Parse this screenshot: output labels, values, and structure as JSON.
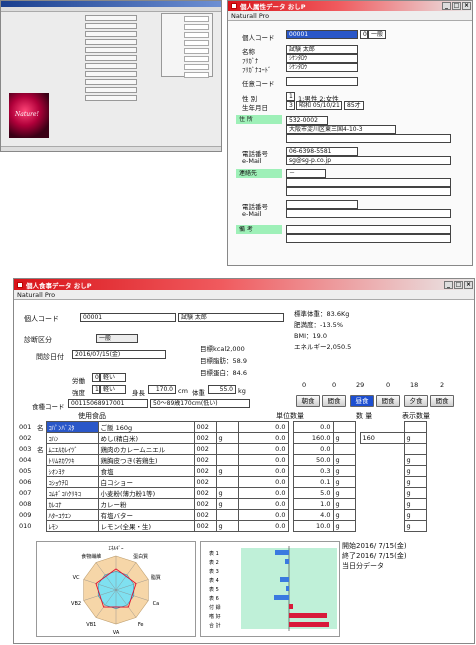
{
  "thumb": {
    "photo_text": "Nature!"
  },
  "pinfo": {
    "title": "個人属性データ おしP",
    "menu": "Naturall Pro",
    "code_label": "個人コード",
    "code_value": "00001",
    "code_type_no": "0",
    "code_type": "一般",
    "name_label": "名称",
    "name_value": "試験 太郎",
    "kana1_label": "ﾌﾘｶﾞﾅ",
    "kana1_value": "ｼｹﾝﾀﾛｳ",
    "kana2_label": "ﾌﾘｶﾞﾅｺｰﾄﾞ",
    "kana2_value": "ｼｹﾝﾀﾛｳ",
    "ncode_label": "任意コード",
    "sex_label": "性 別",
    "sex_value": "1",
    "sex_hint": "1:男性 2:女性",
    "birth_label": "生年月日",
    "birth_era": "3",
    "birth_date": "昭和 05/10/21",
    "birth_age": "85才",
    "addr_label": "住 所",
    "zip": "532-0002",
    "addr1": "大阪市淀川区東三国4-10-3",
    "tel_label": "電話番号",
    "tel_value": "06-6398-5581",
    "mail_label": "e-Mail",
    "mail_value": "sg@sg-p.co.jp",
    "contact_label": "連絡先",
    "contact_value": "－",
    "tel2_label": "電話番号",
    "mail2_label": "e-Mail",
    "note_label": "備 考"
  },
  "diet": {
    "title": "個人食事データ おしP",
    "menu": "Naturall Pro",
    "code_label": "個人コード",
    "code_value": "00001",
    "name_value": "試験 太郎",
    "category_label": "診断区分",
    "category_value": "一般",
    "date_label": "問診日付",
    "date_value": "2016/07/15(金)",
    "target_kcal": "目標kcal2,000",
    "target_fat": "目標脂肪：58.9",
    "target_protein": "目標蛋白：84.6",
    "std_weight": "標準体重：83.6Kg",
    "obesity": "肥満度：-13.5%",
    "bmi": "BMI：19.0",
    "energy": "エネルギー2,050.5",
    "work_label": "労働",
    "work_no": "0",
    "work_value": "軽い",
    "strength_label": "強度",
    "strength_no": "1",
    "strength_value": "軽い",
    "height_label": "身長",
    "height_value": "170.0",
    "height_unit": "cm",
    "weight_label": "体重",
    "weight_value": "55.0",
    "weight_unit": "kg",
    "meal_code_label": "食種コード",
    "meal_code": "00115068917001",
    "meal_desc": "50〜89歳170cm(低い)",
    "meal_counts": [
      "0",
      "0",
      "29",
      "0",
      "18",
      "2"
    ],
    "meal_buttons": [
      "朝食",
      "間食",
      "昼食",
      "間食",
      "夕食",
      "間食"
    ],
    "col_food": "使用食品",
    "col_unit": "単位数量",
    "col_qty": "数 量",
    "col_disp": "表示数量",
    "rows": [
      {
        "no": "001",
        "mark": "名",
        "code": "ｺﾊﾟﾝﾊﾞｽﾀ",
        "food": "ご飯 160g",
        "u": "002",
        "ul": "",
        "uq": "0.0",
        "qty": "0.0",
        "disp": "",
        "dl": ""
      },
      {
        "no": "002",
        "mark": "",
        "code": "ｺﾊﾝ",
        "food": "めし(精白米)",
        "u": "002",
        "ul": "g",
        "uq": "0.0",
        "qty": "160.0",
        "disp": "160",
        "dl": "g"
      },
      {
        "no": "003",
        "mark": "名",
        "code": "ﾑﾆｴﾙｶﾚｲﾂﾞ",
        "food": "鶏肉のカレームニエル",
        "u": "002",
        "ul": "",
        "uq": "0.0",
        "qty": "0.0",
        "disp": "",
        "dl": ""
      },
      {
        "no": "004",
        "mark": "",
        "code": "ﾄﾘﾑﾈｶﾜﾂｷ",
        "food": "鶏胸皮つき(若鶏生)",
        "u": "002",
        "ul": "",
        "uq": "0.0",
        "qty": "50.0",
        "disp": "",
        "dl": "g"
      },
      {
        "no": "005",
        "mark": "",
        "code": "ｼｵﾝﾖｸ",
        "food": "食塩",
        "u": "002",
        "ul": "g",
        "uq": "0.0",
        "qty": "0.3",
        "disp": "",
        "dl": "g"
      },
      {
        "no": "006",
        "mark": "",
        "code": "ｺｼｮｳﾁﾛ",
        "food": "白コショー",
        "u": "002",
        "ul": "",
        "uq": "0.0",
        "qty": "0.1",
        "disp": "",
        "dl": "g"
      },
      {
        "no": "007",
        "mark": "",
        "code": "ｺﾑｷﾞｺﾊｸﾘｷｺ",
        "food": "小麦粉(薄力粉1等)",
        "u": "002",
        "ul": "g",
        "uq": "0.0",
        "qty": "5.0",
        "disp": "",
        "dl": "g"
      },
      {
        "no": "008",
        "mark": "",
        "code": "ｶﾚｺﾅ",
        "food": "カレー粉",
        "u": "002",
        "ul": "g",
        "uq": "0.0",
        "qty": "1.0",
        "disp": "",
        "dl": "g"
      },
      {
        "no": "009",
        "mark": "",
        "code": "ﾊﾀｰﾕｳｴﾝ",
        "food": "有塩バター",
        "u": "002",
        "ul": "",
        "uq": "0.0",
        "qty": "4.0",
        "disp": "",
        "dl": "g"
      },
      {
        "no": "010",
        "mark": "",
        "code": "ﾚﾓﾝ",
        "food": "レモン(全果・生)",
        "u": "002",
        "ul": "g",
        "uq": "0.0",
        "qty": "10.0",
        "disp": "",
        "dl": "g"
      }
    ],
    "radar_labels": [
      "ｴﾈﾙｷﾞｰ",
      "蛋白質",
      "脂質",
      "Ca",
      "Fe",
      "VA",
      "VB1",
      "VB2",
      "VC",
      "食物繊維"
    ],
    "bar_labels": [
      "表 1",
      "表 2",
      "表 3",
      "表 4",
      "表 5",
      "表 6",
      "付 録",
      "嗜 好",
      "合 計"
    ],
    "start_text": "開始2016/ 7/15(金)",
    "end_text": "終了2016/ 7/15(金)",
    "day_text": "当日分データ"
  }
}
